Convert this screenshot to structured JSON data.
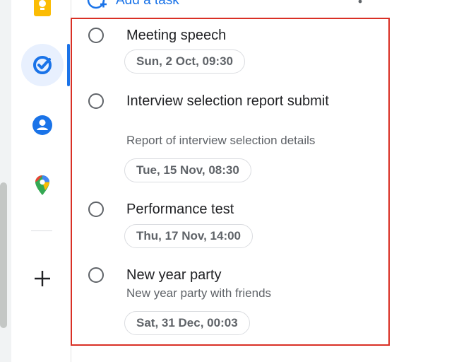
{
  "header": {
    "add_task_label": "Add a task"
  },
  "sidebar": {
    "items": [
      {
        "name": "keep"
      },
      {
        "name": "tasks",
        "active": true
      },
      {
        "name": "contacts"
      },
      {
        "name": "maps"
      },
      {
        "name": "add"
      }
    ]
  },
  "tasks": [
    {
      "title": "Meeting speech",
      "description": "",
      "date": "Sun, 2 Oct, 09:30"
    },
    {
      "title": "Interview selection report submit",
      "description": "Report of interview selection details",
      "date": "Tue, 15 Nov, 08:30"
    },
    {
      "title": "Performance test",
      "description": "",
      "date": "Thu, 17 Nov, 14:00"
    },
    {
      "title": "New year party",
      "description": "New year party with friends",
      "date": "Sat, 31 Dec, 00:03"
    }
  ],
  "colors": {
    "accent": "#1a73e8",
    "highlight_border": "#d93025",
    "keep_yellow": "#fbbc04",
    "text_primary": "#202124",
    "text_secondary": "#5f6368"
  }
}
